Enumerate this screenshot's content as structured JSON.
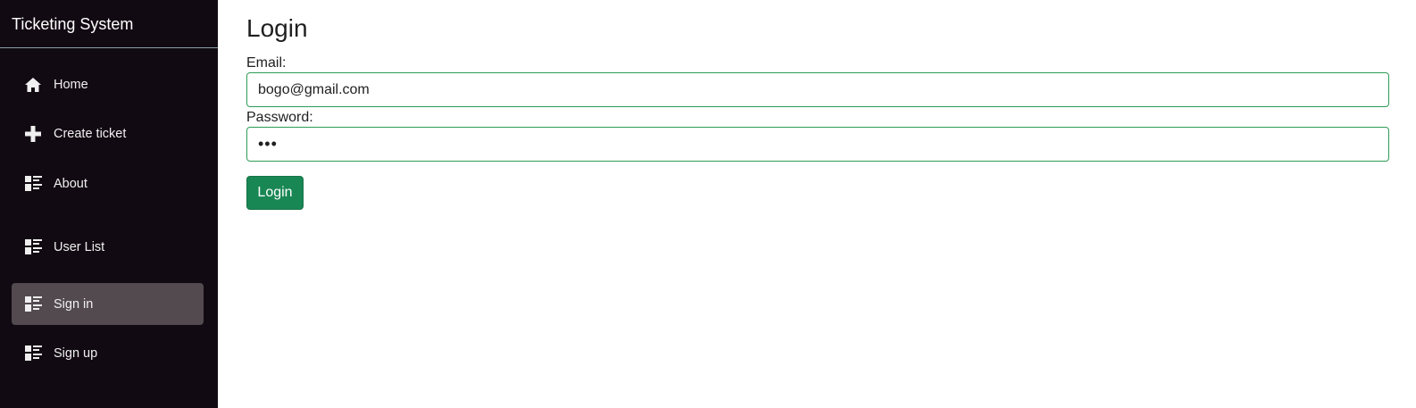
{
  "sidebar": {
    "brand": "Ticketing System",
    "items": [
      {
        "label": "Home",
        "icon": "home-icon"
      },
      {
        "label": "Create ticket",
        "icon": "plus-icon"
      },
      {
        "label": "About",
        "icon": "list-icon"
      },
      {
        "label": "User List",
        "icon": "list-icon"
      },
      {
        "label": "Sign in",
        "icon": "list-icon",
        "active": true
      },
      {
        "label": "Sign up",
        "icon": "list-icon"
      }
    ]
  },
  "main": {
    "title": "Login",
    "email_label": "Email:",
    "email_value": "bogo@gmail.com",
    "password_label": "Password:",
    "password_value": "•••",
    "login_button": "Login"
  },
  "colors": {
    "sidebar_bg": "#120a12",
    "active_item_bg": "#534a50",
    "accent_green": "#198754",
    "input_border": "#2e9c55"
  }
}
